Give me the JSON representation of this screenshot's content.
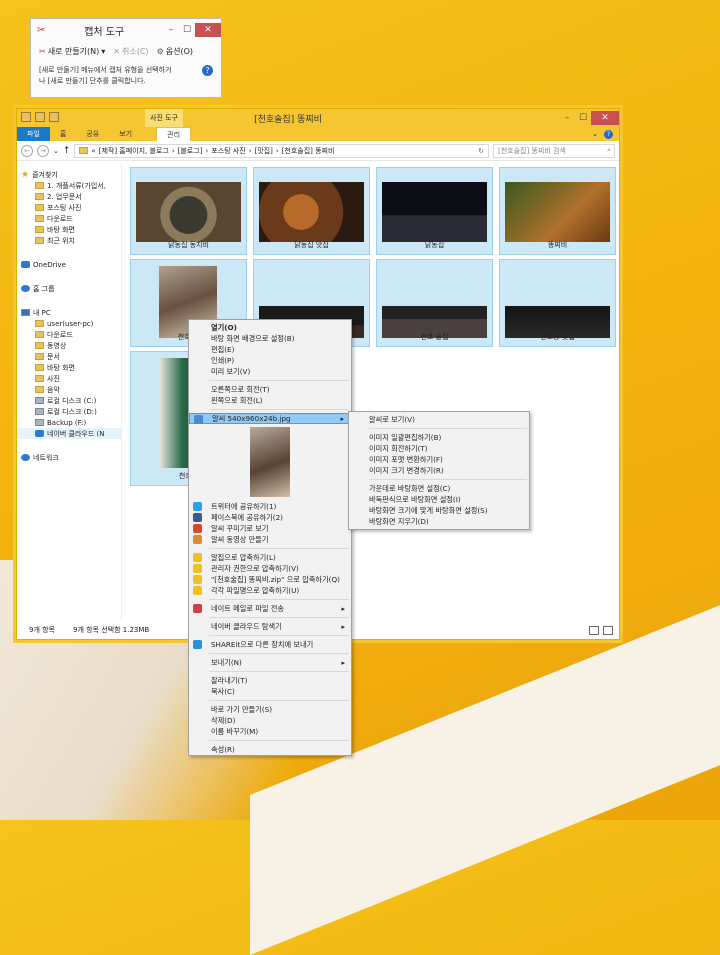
{
  "snip": {
    "title": "캡처 도구",
    "new_label": "새로 만들기(N)",
    "cancel_label": "취소(C)",
    "options_label": "옵션(O)",
    "hint_line1": "[새로 만들기] 메뉴에서 캡처 유형을 선택하거",
    "hint_line2": "나 [새로 만들기] 단추를 클릭합니다."
  },
  "explorer": {
    "context_tab": "사진 도구",
    "title": "[천호술집] 똥찌비",
    "tabs": [
      "파일",
      "홈",
      "공유",
      "보기",
      "관리"
    ],
    "breadcrumb": [
      "«",
      "[제작] 홈페이지, 블로그",
      "[블로그]",
      "포스팅 사진",
      "[맛집]",
      "[천호술집] 똥찌비"
    ],
    "search_placeholder": "[천호술집] 똥찌비 검색",
    "sidebar": [
      {
        "label": "즐겨찾기",
        "icon": "star-icon",
        "level": 0
      },
      {
        "label": "1. 개플서류(가입서,",
        "icon": "folder-icon",
        "level": 1
      },
      {
        "label": "2. 업무문서",
        "icon": "folder-icon",
        "level": 1
      },
      {
        "label": "포스팅 사진",
        "icon": "folder-icon",
        "level": 1
      },
      {
        "label": "다운로드",
        "icon": "folder-icon",
        "level": 1
      },
      {
        "label": "바탕 화면",
        "icon": "folder-icon",
        "level": 1
      },
      {
        "label": "최근 위치",
        "icon": "folder-icon",
        "level": 1
      },
      {
        "label": "OneDrive",
        "icon": "cloud-icon",
        "level": 0
      },
      {
        "label": "홈 그룹",
        "icon": "homegroup-icon",
        "level": 0
      },
      {
        "label": "내 PC",
        "icon": "pc-icon",
        "level": 0
      },
      {
        "label": "user(user-pc)",
        "icon": "folder-icon",
        "level": 1
      },
      {
        "label": "다운로드",
        "icon": "folder-icon",
        "level": 1
      },
      {
        "label": "동영상",
        "icon": "folder-icon",
        "level": 1
      },
      {
        "label": "문서",
        "icon": "folder-icon",
        "level": 1
      },
      {
        "label": "바탕 화면",
        "icon": "folder-icon",
        "level": 1
      },
      {
        "label": "사진",
        "icon": "folder-icon",
        "level": 1
      },
      {
        "label": "음악",
        "icon": "folder-icon",
        "level": 1
      },
      {
        "label": "로컬 디스크 (C:)",
        "icon": "drive-icon",
        "level": 1
      },
      {
        "label": "로컬 디스크 (D:)",
        "icon": "drive-icon",
        "level": 1
      },
      {
        "label": "Backup (F:)",
        "icon": "drive-icon",
        "level": 1
      },
      {
        "label": "네이버 클라우드 (N",
        "icon": "cloud-drive-icon",
        "level": 1
      },
      {
        "label": "네트워크",
        "icon": "network-icon",
        "level": 0
      }
    ],
    "tiles": [
      "닭동집 동지비",
      "닭동집 맛집",
      "닭동집",
      "똥찌비",
      "천호 동",
      "",
      "",
      "천호 술집",
      "천호동 맛집",
      "천호역"
    ],
    "status_count": "9개 항목",
    "status_selected": "9개 항목 선택함 1.23MB"
  },
  "context_menu": {
    "items": [
      {
        "label": "열기(O)",
        "bold": true
      },
      {
        "label": "바탕 화면 배경으로 설정(B)"
      },
      {
        "label": "편집(E)"
      },
      {
        "label": "인쇄(P)"
      },
      {
        "label": "미리 보기(V)"
      },
      {
        "sep": true
      },
      {
        "label": "오른쪽으로 회전(T)"
      },
      {
        "label": "왼쪽으로 회전(L)"
      },
      {
        "sep": true
      },
      {
        "label": "알씨 540x960x24b.jpg",
        "submenu": true,
        "highlight": true,
        "icon": "alsee-icon"
      },
      {
        "preview": true
      },
      {
        "label": "트위터에 공유하기(1)",
        "icon": "twitter-icon"
      },
      {
        "label": "페이스북에 공유하기(2)",
        "icon": "facebook-icon"
      },
      {
        "label": "알씨 꾸미기로 보기",
        "icon": "alsee-decor-icon"
      },
      {
        "label": "알씨 동영상 만들기",
        "icon": "alsee-video-icon"
      },
      {
        "sep": true
      },
      {
        "label": "알집으로 압축하기(L)",
        "icon": "alzip-icon"
      },
      {
        "label": "관리자 권한으로 압축하기(V)",
        "icon": "alzip-admin-icon"
      },
      {
        "label": "\"[천호술집] 똥찌비.zip\" 으로 압축하기(Q)",
        "icon": "alzip-icon"
      },
      {
        "label": "각각 파일명으로 압축하기(U)",
        "icon": "alzip-icon"
      },
      {
        "sep": true
      },
      {
        "label": "네이트 메일로 파일 전송",
        "submenu": true,
        "icon": "nate-icon"
      },
      {
        "sep": true
      },
      {
        "label": "네이버 클라우드 탐색기",
        "submenu": true
      },
      {
        "sep": true
      },
      {
        "label": "SHAREit으로 다른 장치에 보내기",
        "icon": "shareit-icon"
      },
      {
        "sep": true
      },
      {
        "label": "보내기(N)",
        "submenu": true
      },
      {
        "sep": true
      },
      {
        "label": "잘라내기(T)"
      },
      {
        "label": "복사(C)"
      },
      {
        "sep": true
      },
      {
        "label": "바로 가기 만들기(S)"
      },
      {
        "label": "삭제(D)"
      },
      {
        "label": "이름 바꾸기(M)"
      },
      {
        "sep": true
      },
      {
        "label": "속성(R)"
      }
    ]
  },
  "sub_menu": {
    "items": [
      {
        "label": "알씨로 보기(V)"
      },
      {
        "sep": true
      },
      {
        "label": "이미지 일괄편집하기(B)"
      },
      {
        "label": "이미지 회전하기(T)"
      },
      {
        "label": "이미지 포맷 변환하기(F)"
      },
      {
        "label": "이미지 크기 변경하기(R)"
      },
      {
        "sep": true
      },
      {
        "label": "가운데로 바탕화면 설정(C)"
      },
      {
        "label": "바둑판식으로 바탕화면 설정(I)"
      },
      {
        "label": "바탕화면 크기에 맞게 바탕화면 설정(S)"
      },
      {
        "label": "바탕화면 지우기(D)"
      }
    ]
  },
  "colors": {
    "accent": "#f5c631",
    "selection": "#cce8f7",
    "highlight": "#91c9f7"
  }
}
